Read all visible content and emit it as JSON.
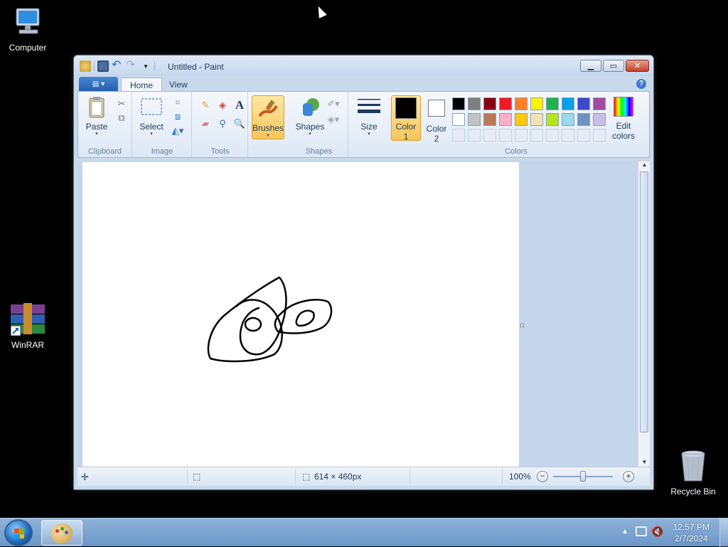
{
  "desktop": {
    "icons": [
      {
        "label": "Computer"
      },
      {
        "label": "WinRAR"
      },
      {
        "label": "Recycle Bin"
      }
    ]
  },
  "window": {
    "title": "Untitled - Paint",
    "tabs": [
      "Home",
      "View"
    ],
    "ribbon": {
      "clipboard": {
        "paste": "Paste",
        "label": "Clipboard"
      },
      "image": {
        "select": "Select",
        "label": "Image"
      },
      "tools": {
        "label": "Tools"
      },
      "brushes": {
        "label": "Brushes"
      },
      "shapes": {
        "shapes": "Shapes",
        "label": "Shapes"
      },
      "size": {
        "label": "Size"
      },
      "colors": {
        "color1_line1": "Color",
        "color1_line2": "1",
        "color2_line1": "Color",
        "color2_line2": "2",
        "edit_line1": "Edit",
        "edit_line2": "colors",
        "label": "Colors",
        "color1": "#000000",
        "color2": "#ffffff",
        "palette_row1": [
          "#000000",
          "#7f7f7f",
          "#880015",
          "#ed1c24",
          "#ff7f27",
          "#fff200",
          "#22b14c",
          "#00a2e8",
          "#3f48cc",
          "#a349a4"
        ],
        "palette_row2": [
          "#ffffff",
          "#c3c3c3",
          "#b97a57",
          "#ffaec9",
          "#ffc90e",
          "#efe4b0",
          "#b5e61d",
          "#99d9ea",
          "#7092be",
          "#c8bfe7"
        ]
      }
    },
    "statusbar": {
      "dimensions": "614 × 460px",
      "zoom": "100%"
    }
  },
  "taskbar": {
    "time": "12:57 PM",
    "date": "2/7/2024"
  }
}
